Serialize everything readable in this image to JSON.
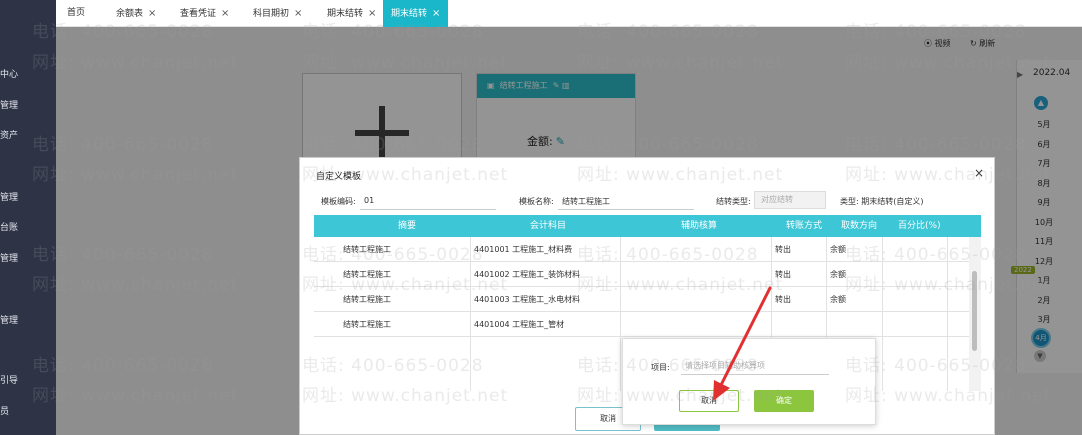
{
  "sidebar": {
    "items": [
      {
        "label": "中心"
      },
      {
        "label": "管理"
      },
      {
        "label": "资产"
      },
      {
        "label": "管理"
      },
      {
        "label": "台账"
      },
      {
        "label": "管理"
      },
      {
        "label": "管理"
      },
      {
        "label": "引导"
      },
      {
        "label": "员"
      }
    ]
  },
  "tabs": [
    {
      "label": "首页",
      "closable": false
    },
    {
      "label": "余额表",
      "closable": true
    },
    {
      "label": "查看凭证",
      "closable": true
    },
    {
      "label": "科目期初",
      "closable": true
    },
    {
      "label": "期末结转",
      "closable": true
    },
    {
      "label": "期末结转",
      "closable": true,
      "active": true
    }
  ],
  "toolbar": {
    "video_label": "视频",
    "refresh_label": "刷新"
  },
  "template_card": {
    "title": "结转工程施工"
  },
  "amount": {
    "label": "金额:"
  },
  "calendar": {
    "year_label": "2022.04",
    "months": [
      "5月",
      "6月",
      "7月",
      "8月",
      "9月",
      "10月",
      "11月",
      "12月",
      "1月",
      "2月",
      "3月"
    ],
    "year_badge": "2022",
    "selected_month": "4月"
  },
  "dialog": {
    "title": "自定义模板",
    "template_code_label": "模板编码:",
    "template_code_value": "01",
    "template_name_label": "模板名称:",
    "template_name_value": "结转工程施工",
    "carry_type_label": "结转类型:",
    "carry_type_placeholder": "对应结转",
    "category_label": "类型: 期末结转(自定义)",
    "columns": [
      "摘要",
      "会计科目",
      "辅助核算",
      "转账方式",
      "取数方向",
      "百分比(%)"
    ],
    "rows": [
      {
        "summary": "结转工程施工",
        "account": "4401001 工程施工_材料费",
        "aux": "",
        "method": "转出",
        "direction": "余额",
        "percent": ""
      },
      {
        "summary": "结转工程施工",
        "account": "4401002 工程施工_装饰材料",
        "aux": "",
        "method": "转出",
        "direction": "余额",
        "percent": ""
      },
      {
        "summary": "结转工程施工",
        "account": "4401003 工程施工_水电材料",
        "aux": "",
        "method": "转出",
        "direction": "余额",
        "percent": ""
      },
      {
        "summary": "结转工程施工",
        "account": "4401004 工程施工_管材",
        "aux": "",
        "method": "",
        "direction": "",
        "percent": ""
      }
    ],
    "cancel_label": "取消"
  },
  "popup": {
    "project_label": "项目:",
    "project_placeholder": "请选择项目辅助核算项",
    "cancel_label": "取消",
    "ok_label": "确定"
  },
  "watermark": {
    "phone": "电话: 400-665-0028",
    "site": "网址: www.chanjet.net"
  },
  "colors": {
    "accent": "#19b7c9",
    "grid_header": "#3cc6d6",
    "confirm": "#8cc63e",
    "arrow": "#e03030",
    "sidebar": "#2e3346"
  }
}
